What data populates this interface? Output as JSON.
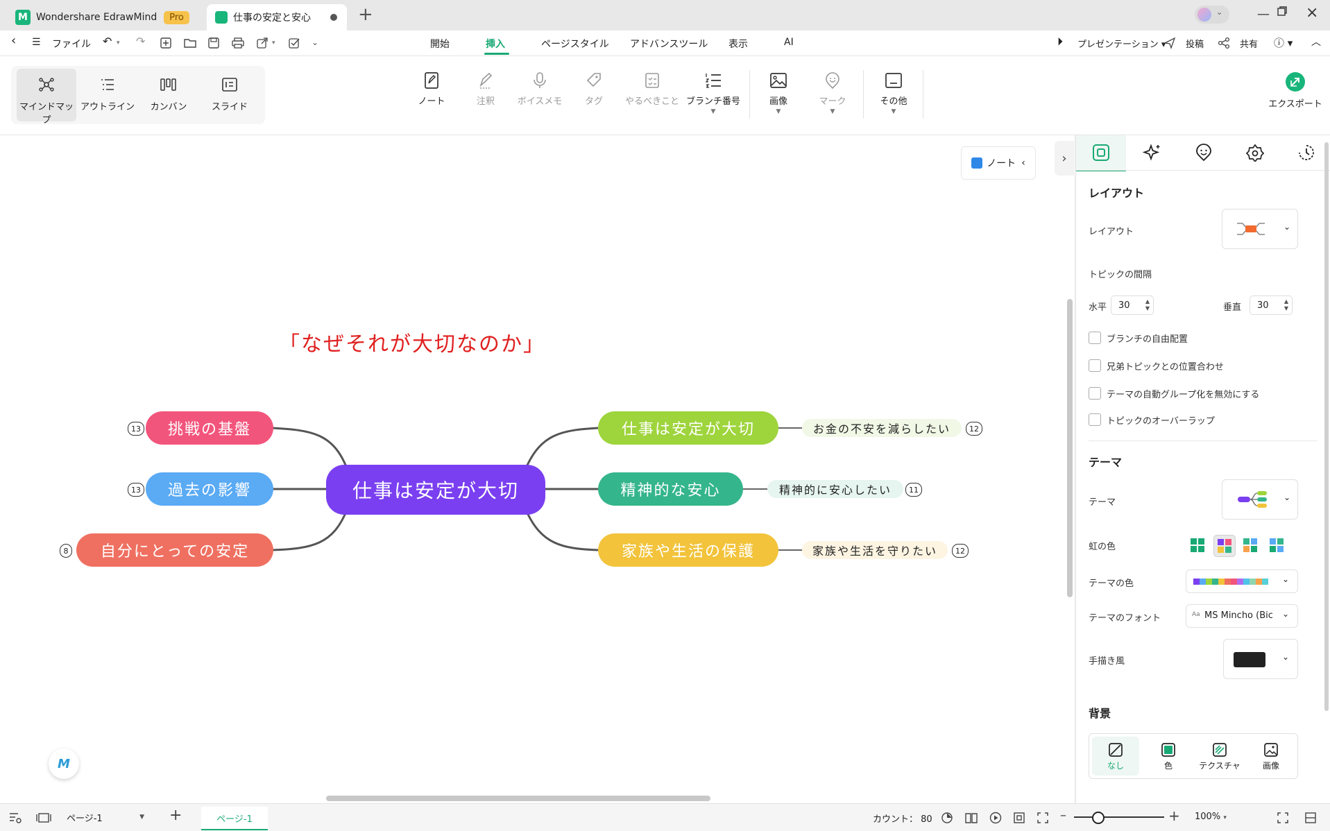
{
  "titlebar": {
    "app_name": "Wondershare EdrawMind",
    "pro_badge": "Pro",
    "doc_tab": "仕事の安定と安心",
    "new_tab": "+"
  },
  "menubar": {
    "file": "ファイル",
    "tabs": [
      "開始",
      "挿入",
      "ページスタイル",
      "アドバンスツール",
      "表示",
      "AI"
    ],
    "active_tab": "挿入",
    "presentation": "プレゼンテーション",
    "post": "投稿",
    "share": "共有"
  },
  "ribbon": {
    "views": [
      {
        "label": "マインドマップ",
        "icon": "mindmap-icon"
      },
      {
        "label": "アウトライン",
        "icon": "outline-icon"
      },
      {
        "label": "カンバン",
        "icon": "kanban-icon"
      },
      {
        "label": "スライド",
        "icon": "slide-icon"
      }
    ],
    "tools": [
      {
        "label": "ノート",
        "icon": "note-icon",
        "enabled": true
      },
      {
        "label": "注釈",
        "icon": "annotation-icon",
        "enabled": false
      },
      {
        "label": "ボイスメモ",
        "icon": "mic-icon",
        "enabled": false
      },
      {
        "label": "タグ",
        "icon": "tag-icon",
        "enabled": false
      },
      {
        "label": "やるべきこと",
        "icon": "todo-icon",
        "enabled": false
      },
      {
        "label": "ブランチ番号",
        "icon": "numbering-icon",
        "enabled": true
      },
      {
        "label": "画像",
        "icon": "image-icon",
        "enabled": true
      },
      {
        "label": "マーク",
        "icon": "mark-icon",
        "enabled": false
      },
      {
        "label": "その他",
        "icon": "more-icon",
        "enabled": true
      }
    ],
    "export": "エクスポート"
  },
  "canvas": {
    "note_button": "ノート",
    "floating_title": "「なぜそれが大切なのか」",
    "central": "仕事は安定が大切",
    "left_topics": [
      {
        "text": "挑戦の基盤",
        "count": "13",
        "color": "#f2557c"
      },
      {
        "text": "過去の影響",
        "count": "13",
        "color": "#5aaaf4"
      },
      {
        "text": "自分にとっての安定",
        "count": "8",
        "color": "#ef7061"
      }
    ],
    "right_topics": [
      {
        "text": "仕事は安定が大切",
        "sub": "お金の不安を減らしたい",
        "count": "12",
        "color": "#9ed43c",
        "subbg": "#f1f8e6"
      },
      {
        "text": "精神的な安心",
        "sub": "精神的に安心したい",
        "count": "11",
        "color": "#35b58c",
        "subbg": "#e6f5ef"
      },
      {
        "text": "家族や生活の保護",
        "sub": "家族や生活を守りたい",
        "count": "12",
        "color": "#f2c33b",
        "subbg": "#fdf4e2"
      }
    ],
    "central_color": "#7a3ff0",
    "title_color": "#e02020"
  },
  "panel": {
    "layout_heading": "レイアウト",
    "layout_label": "レイアウト",
    "spacing_heading": "トピックの間隔",
    "horizontal_label": "水平",
    "horizontal_value": "30",
    "vertical_label": "垂直",
    "vertical_value": "30",
    "checkboxes": [
      "ブランチの自由配置",
      "兄弟トピックとの位置合わせ",
      "テーマの自動グループ化を無効にする",
      "トピックのオーバーラップ"
    ],
    "theme_heading": "テーマ",
    "theme_label": "テーマ",
    "rainbow_label": "虹の色",
    "theme_color_label": "テーマの色",
    "theme_font_label": "テーマのフォント",
    "theme_font_value": "MS Mincho (Bic",
    "handdrawn_label": "手描き風",
    "background_heading": "背景",
    "bg_options": [
      "なし",
      "色",
      "テクスチャ",
      "画像"
    ],
    "palette": [
      "#7a3ff0",
      "#5aaaf4",
      "#9ed43c",
      "#35b58c",
      "#f2c33b",
      "#ef7061",
      "#f2557c",
      "#b06df0",
      "#4fc3e8",
      "#8fd6b0",
      "#f7a24b",
      "#57d0d8"
    ]
  },
  "statusbar": {
    "page_select": "ページ-1",
    "page_tab": "ページ-1",
    "count": "カウント： 80",
    "zoom": "100%"
  }
}
